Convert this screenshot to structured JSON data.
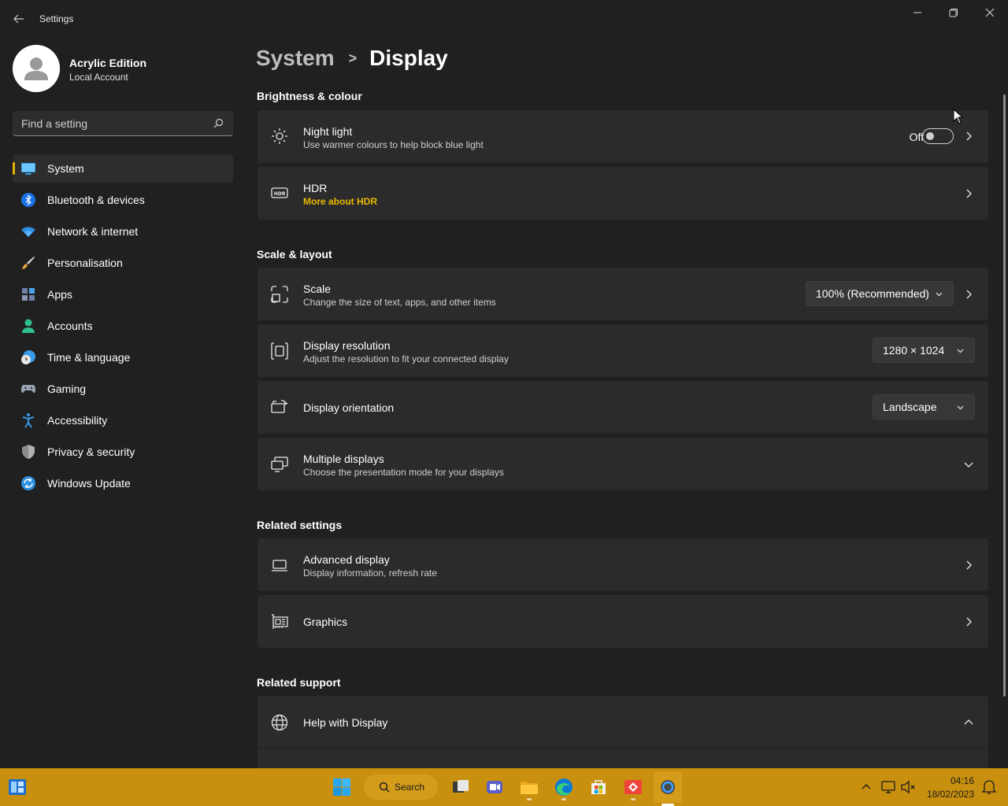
{
  "window": {
    "title": "Settings"
  },
  "profile": {
    "name": "Acrylic Edition",
    "account_type": "Local Account"
  },
  "search": {
    "placeholder": "Find a setting"
  },
  "sidebar": {
    "items": [
      {
        "label": "System",
        "icon": "monitor-icon",
        "active": true
      },
      {
        "label": "Bluetooth & devices",
        "icon": "bluetooth-icon"
      },
      {
        "label": "Network & internet",
        "icon": "wifi-icon"
      },
      {
        "label": "Personalisation",
        "icon": "brush-icon"
      },
      {
        "label": "Apps",
        "icon": "apps-icon"
      },
      {
        "label": "Accounts",
        "icon": "person-icon"
      },
      {
        "label": "Time & language",
        "icon": "clock-globe-icon"
      },
      {
        "label": "Gaming",
        "icon": "gamepad-icon"
      },
      {
        "label": "Accessibility",
        "icon": "accessibility-icon"
      },
      {
        "label": "Privacy & security",
        "icon": "shield-icon"
      },
      {
        "label": "Windows Update",
        "icon": "update-icon"
      }
    ]
  },
  "breadcrumb": {
    "parent": "System",
    "separator": ">",
    "current": "Display"
  },
  "sections": {
    "brightness": "Brightness & colour",
    "scale_layout": "Scale & layout",
    "related_settings": "Related settings",
    "related_support": "Related support"
  },
  "cards": {
    "night_light": {
      "title": "Night light",
      "subtitle": "Use warmer colours to help block blue light",
      "toggle_state": "Off"
    },
    "hdr": {
      "title": "HDR",
      "link": "More about HDR"
    },
    "scale": {
      "title": "Scale",
      "subtitle": "Change the size of text, apps, and other items",
      "value": "100% (Recommended)"
    },
    "resolution": {
      "title": "Display resolution",
      "subtitle": "Adjust the resolution to fit your connected display",
      "value": "1280 × 1024"
    },
    "orientation": {
      "title": "Display orientation",
      "value": "Landscape"
    },
    "multiple": {
      "title": "Multiple displays",
      "subtitle": "Choose the presentation mode for your displays"
    },
    "advanced": {
      "title": "Advanced display",
      "subtitle": "Display information, refresh rate"
    },
    "graphics": {
      "title": "Graphics"
    },
    "help": {
      "title": "Help with Display"
    }
  },
  "taskbar": {
    "search_label": "Search",
    "time": "04:16",
    "date": "18/02/2023"
  },
  "colors": {
    "accent": "#e6b400",
    "taskbar": "#c8900e",
    "background": "#202020",
    "card": "#2b2b2b"
  }
}
